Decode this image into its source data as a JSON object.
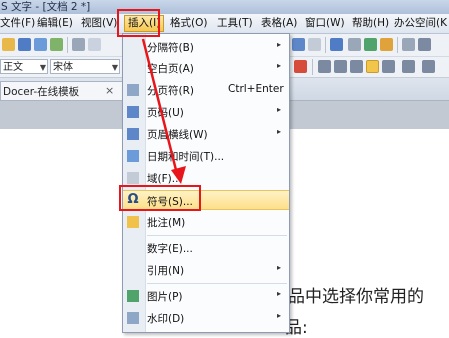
{
  "window": {
    "title": "S 文字 - [文档 2 *]"
  },
  "menubar": {
    "items": [
      "文件(F)",
      "编辑(E)",
      "视图(V)",
      "插入(I)",
      "格式(O)",
      "工具(T)",
      "表格(A)",
      "窗口(W)",
      "帮助(H)",
      "办公空间(K"
    ],
    "active": "插入(I)"
  },
  "toolbar": {
    "style_value": "正文",
    "font_value": "宋体"
  },
  "tabs": {
    "doc_tab": "Docer-在线模板",
    "close": "×"
  },
  "dropdown": {
    "items": [
      {
        "label": "分隔符(B)",
        "shortcut": "",
        "submenu": true
      },
      {
        "label": "空白页(A)",
        "shortcut": "",
        "submenu": true
      },
      {
        "label": "分页符(R)",
        "shortcut": "Ctrl+Enter",
        "submenu": false
      },
      {
        "label": "页码(U)",
        "shortcut": "",
        "submenu": true
      },
      {
        "label": "页眉横线(W)",
        "shortcut": "",
        "submenu": true
      },
      {
        "label": "日期和时间(T)...",
        "shortcut": "",
        "submenu": false
      },
      {
        "label": "域(F)...",
        "shortcut": "",
        "submenu": false
      },
      {
        "label": "符号(S)...",
        "shortcut": "",
        "submenu": false
      },
      {
        "label": "批注(M)",
        "shortcut": "",
        "submenu": false
      },
      {
        "label": "数字(E)...",
        "shortcut": "",
        "submenu": false
      },
      {
        "label": "引用(N)",
        "shortcut": "",
        "submenu": true
      },
      {
        "label": "图片(P)",
        "shortcut": "",
        "submenu": true
      },
      {
        "label": "水印(D)",
        "shortcut": "",
        "submenu": true
      }
    ],
    "submenu_arrow": "▸",
    "highlighted": "符号(S)..."
  },
  "document": {
    "line1": "品中选择你常用的",
    "line2": "品:"
  },
  "colors": {
    "highlight_red": "#e8151b",
    "menu_active": "#f7c84f",
    "hover_item": "#fde08a"
  }
}
